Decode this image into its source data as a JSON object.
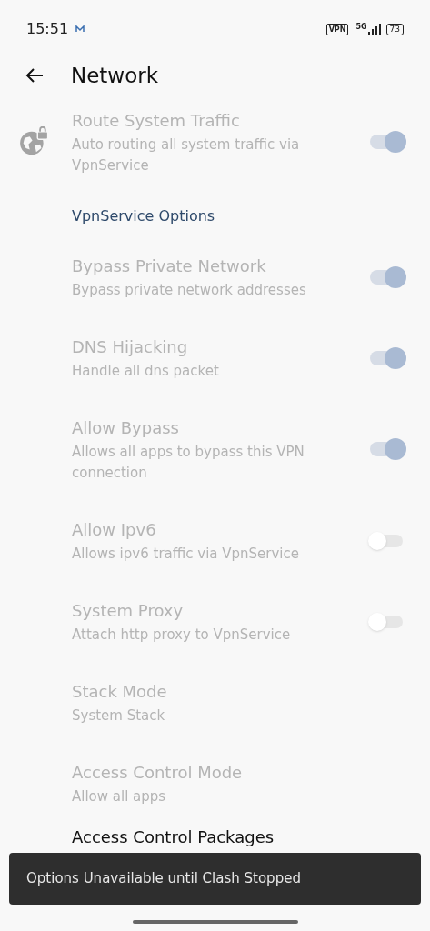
{
  "status_bar": {
    "time": "15:51",
    "vpn_badge": "VPN",
    "network": "5G",
    "battery": "73"
  },
  "toolbar": {
    "title": "Network"
  },
  "items": [
    {
      "kind": "switch",
      "title": "Route System Traffic",
      "subtitle": "Auto routing all system traffic via VpnService",
      "on": true,
      "disabled": true,
      "icon": true
    },
    {
      "kind": "header",
      "title": "VpnService Options"
    },
    {
      "kind": "switch",
      "title": "Bypass Private Network",
      "subtitle": "Bypass private network addresses",
      "on": true,
      "disabled": true
    },
    {
      "kind": "switch",
      "title": "DNS Hijacking",
      "subtitle": "Handle all dns packet",
      "on": true,
      "disabled": true
    },
    {
      "kind": "switch",
      "title": "Allow Bypass",
      "subtitle": "Allows all apps to bypass this VPN connection",
      "on": true,
      "disabled": true
    },
    {
      "kind": "switch",
      "title": "Allow Ipv6",
      "subtitle": "Allows ipv6 traffic via VpnService",
      "on": false,
      "disabled": true
    },
    {
      "kind": "switch",
      "title": "System Proxy",
      "subtitle": "Attach http proxy to VpnService",
      "on": false,
      "disabled": true
    },
    {
      "kind": "value",
      "title": "Stack Mode",
      "subtitle": "System Stack",
      "disabled": true
    },
    {
      "kind": "value",
      "title": "Access Control Mode",
      "subtitle": "Allow all apps",
      "disabled": true
    },
    {
      "kind": "value",
      "title": "Access Control Packages",
      "disabled": false
    }
  ],
  "snackbar": {
    "message": "Options Unavailable until Clash Stopped"
  }
}
